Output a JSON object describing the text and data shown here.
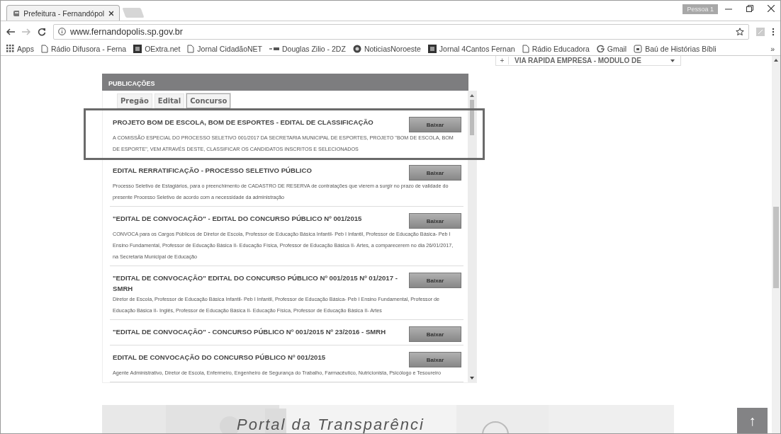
{
  "browser": {
    "tab_title": "Prefeitura - Fernandópol",
    "profile": "Pessoa 1",
    "url": "www.fernandopolis.sp.gov.br",
    "bookmarks": [
      {
        "label": "Apps",
        "kind": "apps"
      },
      {
        "label": "Rádio Difusora - Ferna",
        "kind": "page"
      },
      {
        "label": "OExtra.net",
        "kind": "logo"
      },
      {
        "label": "Jornal CidadãoNET",
        "kind": "page"
      },
      {
        "label": "Douglas Zilio - 2DZ",
        "kind": "mark"
      },
      {
        "label": "NoticiasNoroeste",
        "kind": "globe"
      },
      {
        "label": "Jornal 4Cantos Fernan",
        "kind": "logo"
      },
      {
        "label": "Rádio Educadora",
        "kind": "page"
      },
      {
        "label": "Gmail",
        "kind": "google"
      },
      {
        "label": "Baú de Histórias Bíbli",
        "kind": "badge"
      }
    ],
    "more": "»"
  },
  "side_widget": {
    "expander": "+",
    "label": "VIA RAPIDA EMPRESA - MODULO DE"
  },
  "publications": {
    "title": "PUBLICAÇÕES",
    "tabs": [
      {
        "label": "Pregão",
        "selected": false
      },
      {
        "label": "Edital",
        "selected": false
      },
      {
        "label": "Concurso",
        "selected": true
      }
    ],
    "items": [
      {
        "title": "PROJETO BOM DE ESCOLA, BOM DE ESPORTES - EDITAL DE CLASSIFICAÇÃO",
        "description": "A COMISSÃO ESPECIAL DO PROCESSO SELETIVO 001/2017 DA SECRETARIA MUNICIPAL DE ESPORTES, PROJETO \"BOM DE ESCOLA, BOM DE ESPORTE\", VEM ATRAVÉS DESTE, CLASSIFICAR OS CANDIDATOS INSCRITOS E SELECIONADOS",
        "button": "Baixar",
        "highlighted": true
      },
      {
        "title": "EDITAL RERRATIFICAÇÃO - PROCESSO SELETIVO PÚBLICO",
        "description": "Processo Seletivo de Estagiários, para o preenchimento de CADASTRO DE RESERVA de contratações que vierem a surgir no prazo de validade do presente Processo Seletivo de acordo com a necessidade da administração",
        "button": "Baixar",
        "highlighted": false
      },
      {
        "title": "\"EDITAL DE CONVOCAÇÃO\" - EDITAL DO CONCURSO PÚBLICO Nº 001/2015",
        "description": "CONVOCA para os Cargos Públicos de Diretor de Escola, Professor de Educação Básica Infantil- Peb I Infantil, Professor de Educação Básica- Peb I Ensino Fundamental, Professor de Educação Básica II- Educação Física, Professor de Educação Básica II- Artes, a comparecerem no dia 26/01/2017, na Secretaria Municipal de Educação",
        "button": "Baixar",
        "highlighted": false
      },
      {
        "title": "\"EDITAL DE CONVOCAÇÃO\" EDITAL DO CONCURSO PÚBLICO Nº 001/2015 Nº 01/2017 - SMRH",
        "description": "Diretor de Escola, Professor de Educação Básica Infantil- Peb I Infantil, Professor de Educação Básica- Peb I Ensino Fundamental, Professor de Educação Básica II- Inglês, Professor de Educação Básica II- Educação Física, Professor de Educação Básica II- Artes",
        "button": "Baixar",
        "highlighted": false
      },
      {
        "title": "\"EDITAL DE CONVOCAÇÃO\" - CONCURSO PÚBLICO Nº 001/2015 Nº 23/2016 - SMRH",
        "button": "Baixar",
        "highlighted": false
      },
      {
        "title": "EDITAL DE CONVOCAÇÃO DO CONCURSO PÚBLICO Nº 001/2015",
        "description": "Agente Administrativo, Diretor de Escola, Enfermeiro, Engenheiro de Segurança do Trabalho, Farmacêutico, Nutricionista, Psicólogo e Tesoureiro",
        "button": "Baixar",
        "highlighted": false
      }
    ]
  },
  "banner": {
    "text": "Portal da Transparênci"
  },
  "back_to_top": "↑"
}
